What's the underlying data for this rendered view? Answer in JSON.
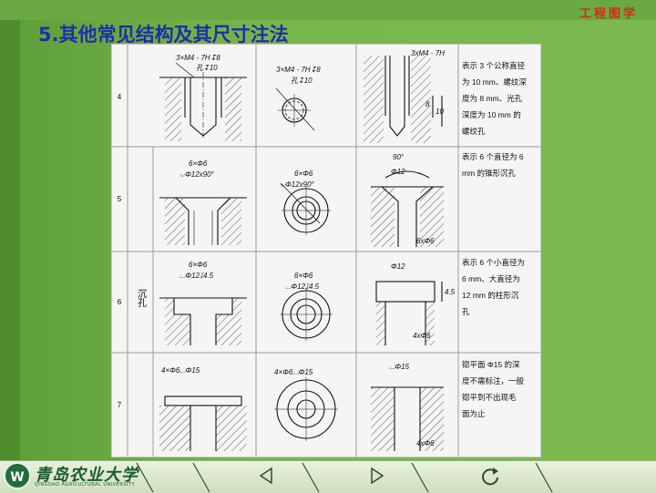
{
  "header": {
    "course_tag": "工程图学"
  },
  "slide": {
    "title": "5.其他常见结构及其尺寸注法"
  },
  "table": {
    "rows": [
      {
        "num": "4",
        "group": "",
        "ann1": [
          "3×M4 - 7H↧8",
          "孔↧10"
        ],
        "ann2": [
          "3×M4 - 7H↧8",
          "孔↧10"
        ],
        "ann3": [
          "3xM4 - 7H",
          "8",
          "10"
        ],
        "desc": [
          "表示 3 个公称直径",
          "为 10 mm、螺纹深",
          "度为 8 mm、光孔",
          "深度为 10 mm 的",
          "螺纹孔"
        ]
      },
      {
        "num": "5",
        "group": "",
        "ann1": [
          "6×Φ6",
          "⌵Φ12x90°"
        ],
        "ann2": [
          "6×Φ6",
          "⌵Φ12x90°"
        ],
        "ann3": [
          "90°",
          "Φ12",
          "6xΦ6"
        ],
        "desc": [
          "表示 6 个直径为 6",
          "mm 的锥形沉孔"
        ]
      },
      {
        "num": "6",
        "group": "沉孔",
        "ann1": [
          "6×Φ6",
          "⌴Φ12↧4.5"
        ],
        "ann2": [
          "6×Φ6",
          "⌴Φ12↧4.5"
        ],
        "ann3": [
          "Φ12",
          "4.5",
          "4xΦ6"
        ],
        "desc": [
          "表示 6 个小直径为",
          "6 mm、大直径为",
          "12 mm 的柱形沉",
          "孔"
        ]
      },
      {
        "num": "7",
        "group": "",
        "ann1": [
          "4×Φ6⌴Φ15"
        ],
        "ann2": [
          "4×Φ6⌴Φ15"
        ],
        "ann3": [
          "⌴Φ15",
          "4xΦ6"
        ],
        "desc": [
          "锪平面 Φ15 的深",
          "度不需标注，一般",
          "锪平到不出现毛",
          "面为止"
        ]
      }
    ]
  },
  "footer": {
    "university_cn": "青岛农业大学",
    "university_en": "QINGDAO AGRICULTURAL UNIVERSITY",
    "logo_text": "W",
    "prev_icon": "triangle-left",
    "next_icon": "triangle-right",
    "return_icon": "circular-arrow"
  },
  "colors": {
    "title": "#1f2fa8",
    "course_tag": "#d8261c",
    "background": "#6fae45"
  }
}
